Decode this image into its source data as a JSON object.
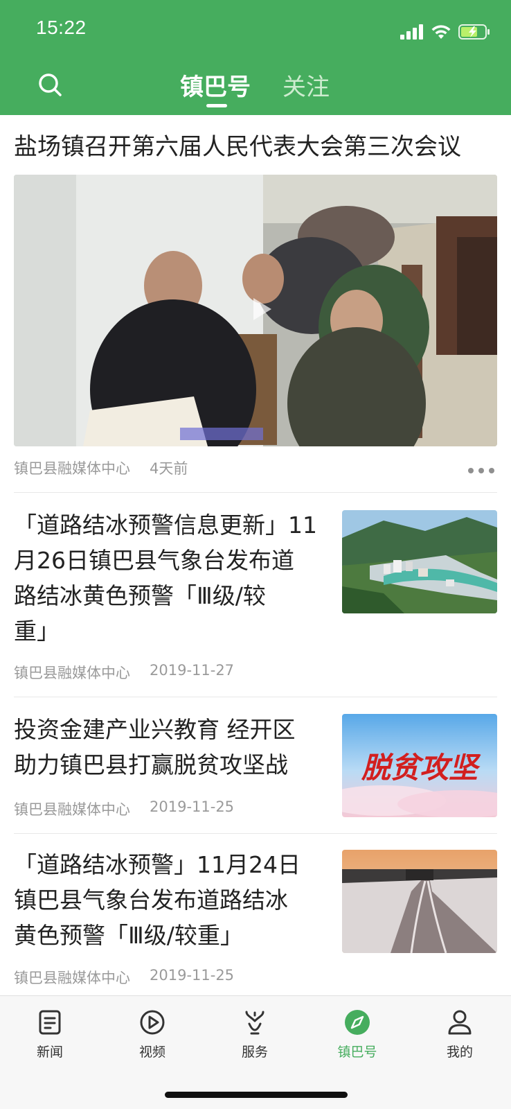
{
  "status_bar": {
    "time": "15:22"
  },
  "header": {
    "tabs": [
      {
        "label": "镇巴号",
        "active": true
      },
      {
        "label": "关注",
        "active": false
      }
    ],
    "color": "#46ad5e"
  },
  "featured": {
    "title": "盐场镇召开第六届人民代表大会第三次会议",
    "source": "镇巴县融媒体中心",
    "time": "4天前"
  },
  "articles": [
    {
      "title_lines": [
        "「道路结冰预警信息更新」11",
        "月26日镇巴县气象台发布道",
        "路结冰黄色预警「Ⅲ级/较",
        "重」"
      ],
      "source": "镇巴县融媒体中心",
      "date": "2019-11-27"
    },
    {
      "title_lines": [
        "投资金建产业兴教育 经开区",
        "助力镇巴县打赢脱贫攻坚战"
      ],
      "source": "镇巴县融媒体中心",
      "date": "2019-11-25",
      "thumb_text": "脱贫攻坚"
    },
    {
      "title_lines": [
        "「道路结冰预警」11月24日",
        "镇巴县气象台发布道路结冰",
        "黄色预警「Ⅲ级/较重」"
      ],
      "source": "镇巴县融媒体中心",
      "date": "2019-11-25"
    }
  ],
  "bottom_nav": [
    {
      "label": "新闻",
      "icon": "news-icon",
      "active": false
    },
    {
      "label": "视频",
      "icon": "video-icon",
      "active": false
    },
    {
      "label": "服务",
      "icon": "service-icon",
      "active": false
    },
    {
      "label": "镇巴号",
      "icon": "compass-icon",
      "active": true
    },
    {
      "label": "我的",
      "icon": "profile-icon",
      "active": false
    }
  ]
}
